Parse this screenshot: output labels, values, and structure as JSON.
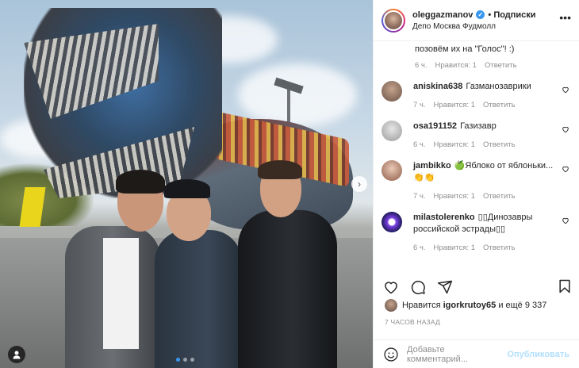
{
  "post": {
    "username": "oleggazmanov",
    "follow_label": "• Подписки",
    "location": "Депо Москва Фудмолл",
    "more_icon": "more-horizontal-icon"
  },
  "comments_first": {
    "text": "позовём их на \"Голос\"! :)",
    "time": "6 ч.",
    "likes": "Нравится: 1",
    "reply": "Ответить"
  },
  "comments": [
    {
      "username": "aniskina638",
      "text": "Газманозаврики",
      "time": "7 ч.",
      "likes": "Нравится: 1",
      "reply": "Ответить"
    },
    {
      "username": "osa191152",
      "text": "Газизавр",
      "time": "6 ч.",
      "likes": "Нравится: 1",
      "reply": "Ответить"
    },
    {
      "username": "jambikko",
      "text": "🍏Яблоко от яблоньки...👏👏",
      "time": "7 ч.",
      "likes": "Нравится: 1",
      "reply": "Ответить"
    },
    {
      "username": "milastolerenko",
      "text": "▯▯Динозавры российской эстрады▯▯",
      "time": "6 ч.",
      "likes": "Нравится: 1",
      "reply": "Ответить"
    }
  ],
  "likes": {
    "prefix": "Нравится",
    "user": "igorkrutoy65",
    "suffix": "и ещё 9 337"
  },
  "timestamp": "7 ЧАСОВ НАЗАД",
  "add_comment": {
    "placeholder": "Добавьте комментарий...",
    "publish": "Опубликовать"
  },
  "colors": {
    "accent": "#3897f0",
    "muted": "#8e8e8e",
    "publish_disabled": "#b2dffc"
  }
}
